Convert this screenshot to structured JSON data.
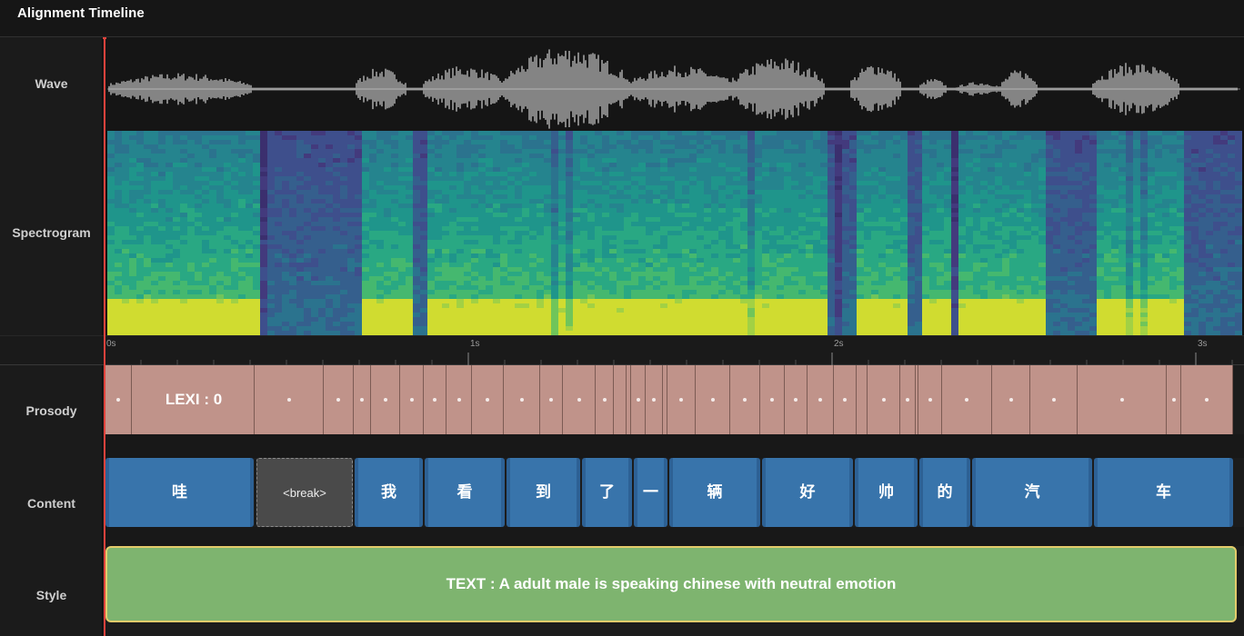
{
  "header": {
    "title": "Alignment Timeline"
  },
  "labels": {
    "wave": "Wave",
    "spectrogram": "Spectrogram",
    "prosody": "Prosody",
    "content": "Content",
    "style": "Style"
  },
  "ruler": {
    "ticks": [
      "0s",
      "1s",
      "2s",
      "3s"
    ]
  },
  "prosody": {
    "highlighted_label": "LEXI : 0"
  },
  "content": {
    "tokens": [
      "哇",
      "<break>",
      "我",
      "看",
      "到",
      "了",
      "一",
      "辆",
      "好",
      "帅",
      "的",
      "汽",
      "车"
    ]
  },
  "style": {
    "text": "TEXT : A adult male is speaking chinese with neutral emotion"
  },
  "colors": {
    "background": "#1c1c1c",
    "prosody_segment": "#c0938a",
    "content_segment": "#3874ab",
    "break_segment": "#4a4a4a",
    "style_block": "#7eb46f",
    "style_border": "#e3cb6b",
    "playhead": "#e0423c"
  },
  "icons": {
    "playhead": "playhead-marker"
  }
}
